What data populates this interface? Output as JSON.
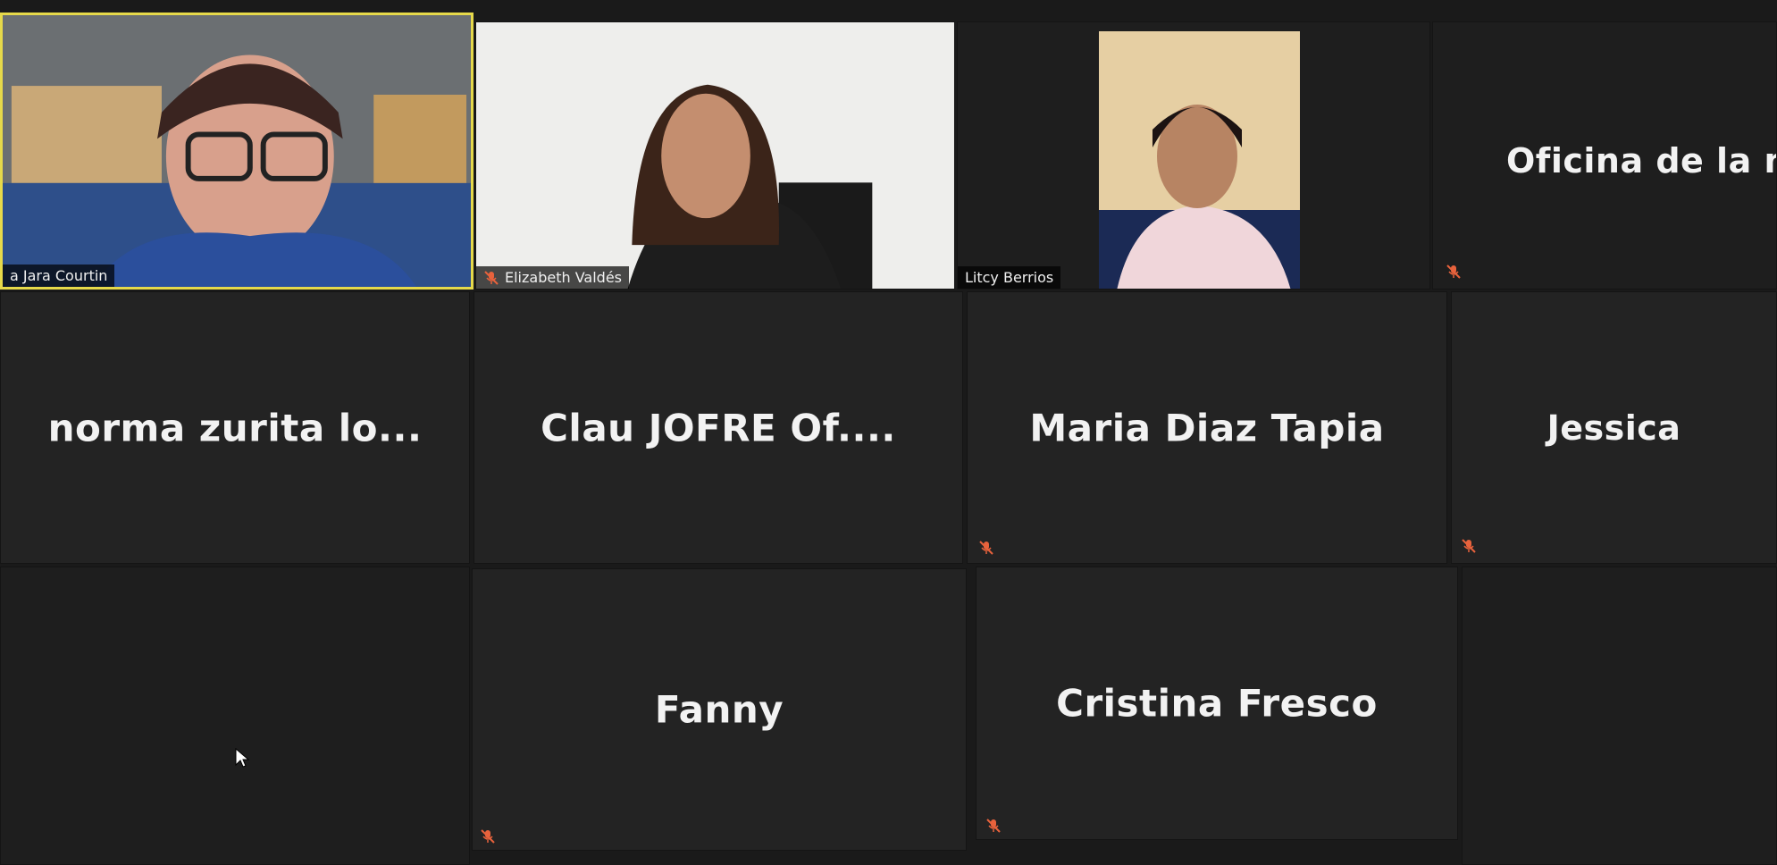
{
  "participants": {
    "p1": {
      "name": "a Jara Courtin",
      "muted": false,
      "video": true
    },
    "p2": {
      "name": "Elizabeth Valdés",
      "muted": true,
      "video": true
    },
    "p3": {
      "name": "Litcy Berrios",
      "muted": false,
      "video": true
    },
    "p4": {
      "name": "Oficina de la m",
      "muted": true,
      "video": false
    },
    "p5": {
      "name": "norma  zurita  lo...",
      "muted": false,
      "video": false
    },
    "p6": {
      "name": "Clau JOFRE Of....",
      "muted": false,
      "video": false
    },
    "p7": {
      "name": "Maria Diaz Tapia",
      "muted": true,
      "video": false
    },
    "p8": {
      "name": "Jessica",
      "muted": true,
      "video": false
    },
    "p9": {
      "name": "Fanny",
      "muted": true,
      "video": false
    },
    "p10": {
      "name": "Cristina Fresco",
      "muted": true,
      "video": false
    }
  },
  "colors": {
    "active_speaker_border": "#e6d94a",
    "mute_icon": "#e8623c",
    "tile_bg": "#232323",
    "name_text": "#f2f2f2"
  },
  "icons": {
    "mute": "microphone-muted-icon",
    "cursor": "mouse-pointer-icon"
  }
}
